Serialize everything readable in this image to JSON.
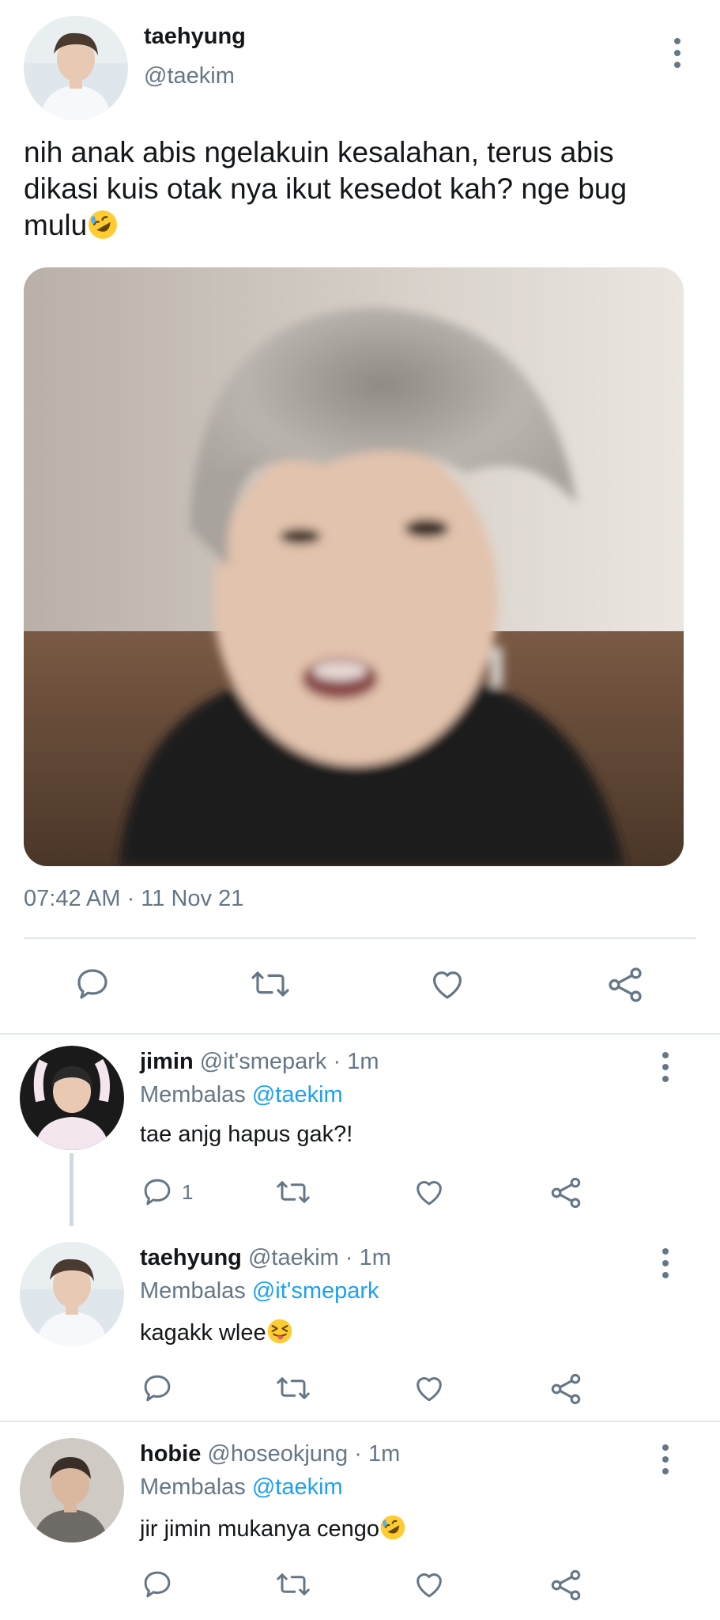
{
  "tweet": {
    "name": "taehyung",
    "handle": "@taekim",
    "text": "nih anak abis ngelakuin kesalahan, terus abis dikasi kuis otak nya ikut kesedot kah? nge bug mulu",
    "text_emoji": "rolling-on-floor-laughing-emoji",
    "timestamp": "07:42 AM · 11 Nov 21",
    "actions": [
      "reply-icon",
      "retweet-icon",
      "like-icon",
      "share-icon"
    ]
  },
  "replies": [
    {
      "name": "jimin",
      "handle": "@it'smepark",
      "time": "· 1m",
      "replying_label": "Membalas",
      "replying_to": "@taekim",
      "text": "tae anjg hapus gak?!",
      "reply_count": "1"
    },
    {
      "name": "taehyung",
      "handle": "@taekim",
      "time": "· 1m",
      "replying_label": "Membalas",
      "replying_to": "@it'smepark",
      "text": "kagakk wlee",
      "text_emoji": "squinting-face-with-tongue-emoji",
      "reply_count": ""
    },
    {
      "name": "hobie",
      "handle": "@hoseokjung",
      "time": "· 1m",
      "replying_label": "Membalas",
      "replying_to": "@taekim",
      "text": "jir jimin mukanya cengo",
      "text_emoji": "rolling-on-floor-laughing-emoji",
      "reply_count": ""
    }
  ],
  "colors": {
    "accent": "#1da1f2",
    "secondary_text": "#657786",
    "divider": "#e1e8ed"
  }
}
